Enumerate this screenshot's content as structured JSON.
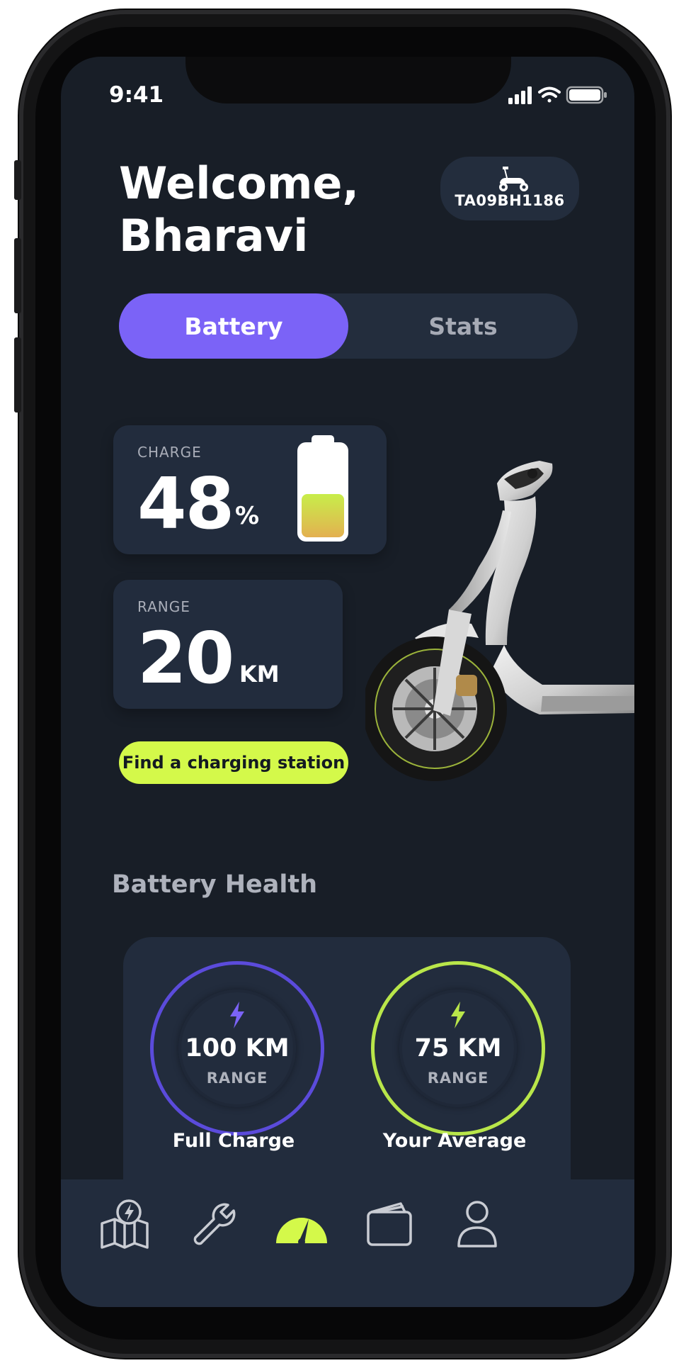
{
  "status_bar": {
    "time": "9:41"
  },
  "header": {
    "welcome_line1": "Welcome,",
    "welcome_line2": "Bharavi",
    "plate": "TA09BH1186"
  },
  "tabs": [
    {
      "label": "Battery",
      "active": true
    },
    {
      "label": "Stats",
      "active": false
    }
  ],
  "charge": {
    "label": "CHARGE",
    "value": "48",
    "unit": "%",
    "level_percent": 48
  },
  "range": {
    "label": "RANGE",
    "value": "20",
    "unit": "KM"
  },
  "find_station_label": "Find a charging station",
  "battery_health": {
    "title": "Battery Health",
    "rings": [
      {
        "value": "100 KM",
        "sub": "RANGE",
        "caption": "Full Charge",
        "color": "#5b4bdb"
      },
      {
        "value": "75 KM",
        "sub": "RANGE",
        "caption": "Your Average",
        "color": "#b9e64a"
      }
    ]
  },
  "bottom_nav": [
    {
      "icon": "map-charging-icon",
      "active": false
    },
    {
      "icon": "wrench-icon",
      "active": false
    },
    {
      "icon": "speedometer-icon",
      "active": true
    },
    {
      "icon": "wallet-icon",
      "active": false
    },
    {
      "icon": "profile-icon",
      "active": false
    }
  ],
  "colors": {
    "background": "#181e27",
    "card": "#222c3d",
    "accent_purple": "#7b63f7",
    "accent_lime": "#d4f94a"
  }
}
